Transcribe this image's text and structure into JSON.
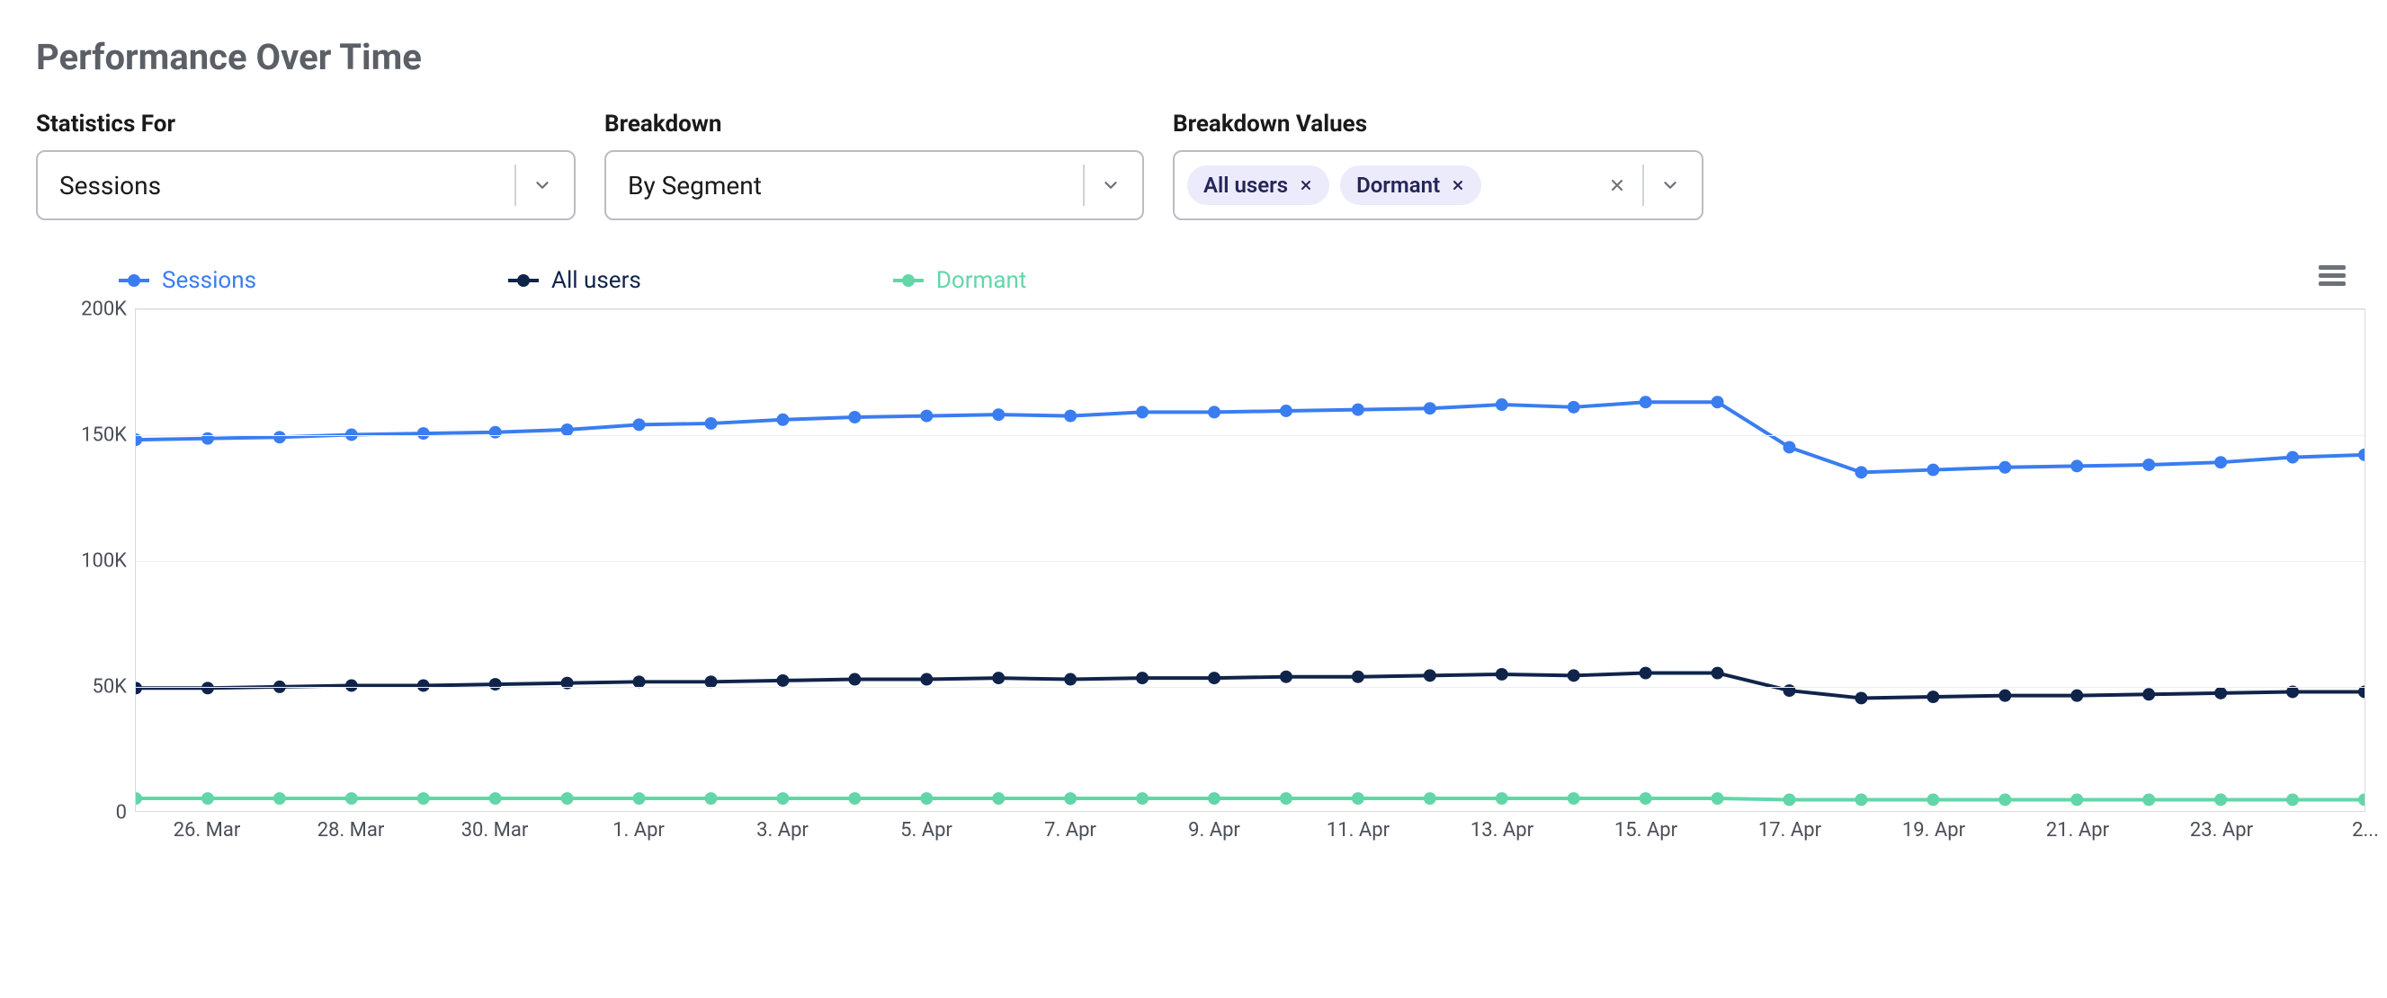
{
  "title": "Performance Over Time",
  "controls": {
    "statistics_for": {
      "label": "Statistics For",
      "value": "Sessions"
    },
    "breakdown": {
      "label": "Breakdown",
      "value": "By Segment"
    },
    "breakdown_values": {
      "label": "Breakdown Values",
      "chips": [
        "All users",
        "Dormant"
      ]
    }
  },
  "legend": [
    {
      "name": "Sessions",
      "color": "#3a7df0"
    },
    {
      "name": "All users",
      "color": "#10244a"
    },
    {
      "name": "Dormant",
      "color": "#63d6a8"
    }
  ],
  "chart_data": {
    "type": "line",
    "ylim": [
      0,
      200000
    ],
    "y_ticks": [
      0,
      50000,
      100000,
      150000,
      200000
    ],
    "y_tick_labels": [
      "0",
      "50K",
      "100K",
      "150K",
      "200K"
    ],
    "x": [
      "25. Mar",
      "26. Mar",
      "27. Mar",
      "28. Mar",
      "29. Mar",
      "30. Mar",
      "31. Mar",
      "1. Apr",
      "2. Apr",
      "3. Apr",
      "4. Apr",
      "5. Apr",
      "6. Apr",
      "7. Apr",
      "8. Apr",
      "9. Apr",
      "10. Apr",
      "11. Apr",
      "12. Apr",
      "13. Apr",
      "14. Apr",
      "15. Apr",
      "16. Apr",
      "17. Apr",
      "18. Apr",
      "19. Apr",
      "20. Apr",
      "21. Apr",
      "22. Apr",
      "23. Apr",
      "24. Apr",
      "25. Apr"
    ],
    "x_tick_labels": [
      "26. Mar",
      "28. Mar",
      "30. Mar",
      "1. Apr",
      "3. Apr",
      "5. Apr",
      "7. Apr",
      "9. Apr",
      "11. Apr",
      "13. Apr",
      "15. Apr",
      "17. Apr",
      "19. Apr",
      "21. Apr",
      "23. Apr",
      "2..."
    ],
    "x_tick_indices": [
      1,
      3,
      5,
      7,
      9,
      11,
      13,
      15,
      17,
      19,
      21,
      23,
      25,
      27,
      29,
      31
    ],
    "series": [
      {
        "name": "Sessions",
        "color": "#3a7df0",
        "values": [
          148000,
          148500,
          149000,
          150000,
          150500,
          151000,
          152000,
          154000,
          154500,
          156000,
          157000,
          157500,
          158000,
          157500,
          159000,
          159000,
          159500,
          160000,
          160500,
          162000,
          161000,
          163000,
          163000,
          145000,
          135000,
          136000,
          137000,
          137500,
          138000,
          139000,
          141000,
          142000
        ]
      },
      {
        "name": "All users",
        "color": "#10244a",
        "values": [
          49000,
          49000,
          49500,
          50000,
          50000,
          50500,
          51000,
          51500,
          51500,
          52000,
          52500,
          52500,
          53000,
          52500,
          53000,
          53000,
          53500,
          53500,
          54000,
          54500,
          54000,
          55000,
          55000,
          48000,
          45000,
          45500,
          46000,
          46000,
          46500,
          47000,
          47500,
          47500
        ]
      },
      {
        "name": "Dormant",
        "color": "#63d6a8",
        "values": [
          5000,
          5000,
          5000,
          5000,
          5000,
          5000,
          5000,
          5000,
          5000,
          5000,
          5000,
          5000,
          5000,
          5000,
          5000,
          5000,
          5000,
          5000,
          5000,
          5000,
          5000,
          5000,
          5000,
          4500,
          4500,
          4500,
          4500,
          4500,
          4500,
          4500,
          4500,
          4500
        ]
      }
    ]
  }
}
